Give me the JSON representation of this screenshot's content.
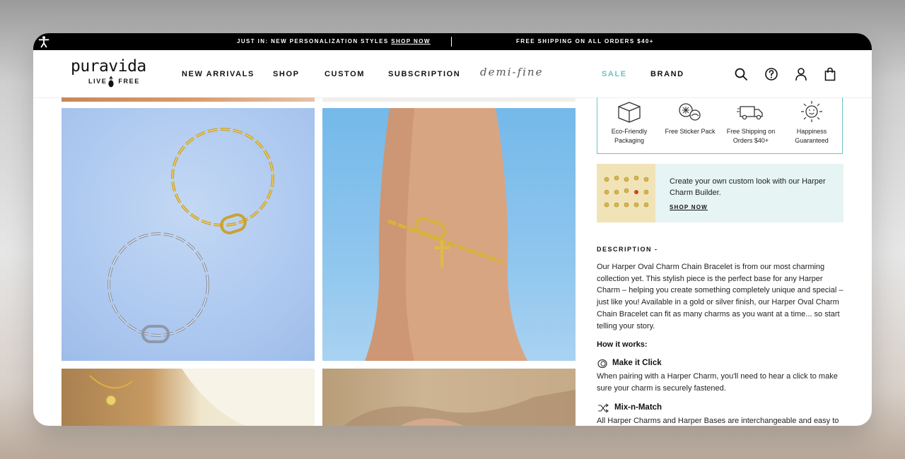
{
  "promo": {
    "left_text": "JUST IN: NEW PERSONALIZATION STYLES ",
    "left_link": "SHOP NOW",
    "right_text": "FREE SHIPPING ON ALL ORDERS $40+"
  },
  "header": {
    "logo_main": "puravida",
    "logo_sub_left": "LIVE",
    "logo_sub_right": "FREE",
    "nav": [
      "NEW ARRIVALS",
      "SHOP",
      "CUSTOM",
      "SUBSCRIPTION",
      "demi-fine",
      "SALE",
      "BRAND"
    ],
    "icons": [
      "search-icon",
      "help-icon",
      "account-icon",
      "bag-icon"
    ],
    "sale_color": "#6cc3c4"
  },
  "perks": [
    {
      "label": "Eco-Friendly Packaging",
      "icon": "box-icon"
    },
    {
      "label": "Free Sticker Pack",
      "icon": "sticker-icon"
    },
    {
      "label": "Free Shipping on Orders $40+",
      "icon": "truck-icon"
    },
    {
      "label": "Happiness Guaranteed",
      "icon": "sun-icon"
    }
  ],
  "charm_builder": {
    "text": "Create your own custom look with our Harper Charm Builder.",
    "link": "SHOP NOW"
  },
  "description": {
    "heading": "DESCRIPTION -",
    "body": "Our Harper Oval Charm Chain Bracelet is from our most charming collection yet. This stylish piece is the perfect base for any Harper Charm – helping you create something completely unique and special – just like you! Available in a gold or silver finish, our Harper Oval Charm Chain Bracelet can fit as many charms as you want at a time... so start telling your story."
  },
  "how_it_works": {
    "heading": "How it works:",
    "features": [
      {
        "title": "Make it Click",
        "icon": "click-icon",
        "body": "When pairing with a Harper Charm, you'll need to hear a click to make sure your charm is securely fastened."
      },
      {
        "title": "Mix-n-Match",
        "icon": "shuffle-icon",
        "body": "All Harper Charms and Harper Bases are interchangeable and easy to mix-n-match."
      }
    ]
  },
  "accent_color": "#6cc3c4"
}
